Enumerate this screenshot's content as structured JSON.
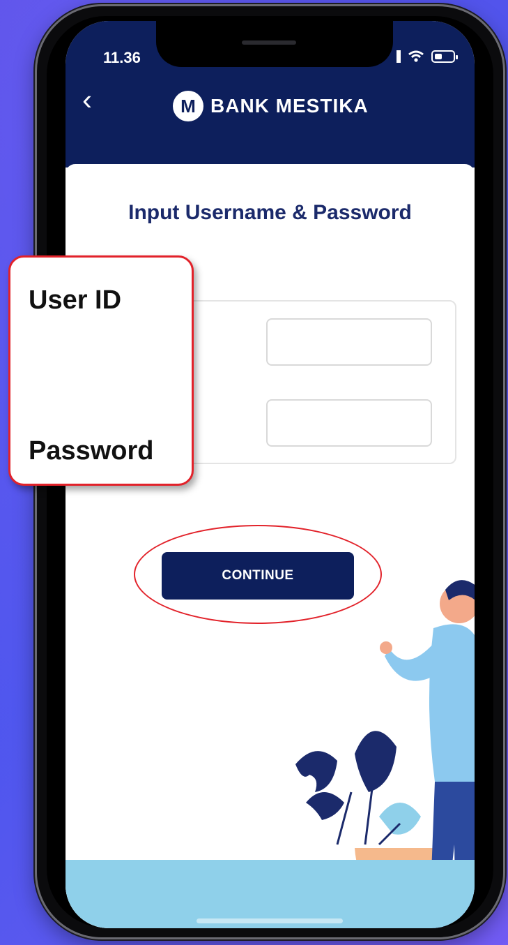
{
  "status_bar": {
    "time": "11.36"
  },
  "header": {
    "back_icon": "chevron-left-icon",
    "logo_letter": "M",
    "brand_name": "BANK MESTIKA"
  },
  "page": {
    "title": "Input Username & Password"
  },
  "form": {
    "user_id_label": "User ID",
    "password_label": "Password",
    "user_id_value": "",
    "password_value": ""
  },
  "actions": {
    "continue_label": "CONTINUE"
  },
  "colors": {
    "header_navy": "#0d1f5c",
    "accent_red": "#e2222a",
    "background_violet": "#5a4fe6"
  }
}
